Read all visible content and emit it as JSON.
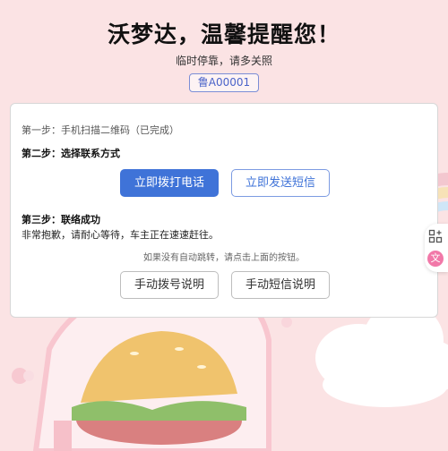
{
  "header": {
    "title": "沃梦达，温馨提醒您！",
    "subtitle": "临时停靠，请多关照",
    "plate": "鲁A00001"
  },
  "card": {
    "step1": "第一步：手机扫描二维码（已完成）",
    "step2": "第二步：选择联系方式",
    "call_button": "立即拨打电话",
    "sms_button": "立即发送短信",
    "step3": "第三步：联络成功",
    "sorry_text": "非常抱歉，请耐心等待，车主正在速速赶往。",
    "hint_text": "如果没有自动跳转，请点击上面的按钮。",
    "call_help_button": "手动拨号说明",
    "sms_help_button": "手动短信说明"
  },
  "side_tools": {
    "tool1_icon": "grid-plus-icon",
    "tool2_icon": "translate-icon",
    "tool2_glyph": "文"
  },
  "colors": {
    "background": "#fbe3e4",
    "primary": "#3f73d8",
    "plate_border": "#7b8ed6"
  }
}
